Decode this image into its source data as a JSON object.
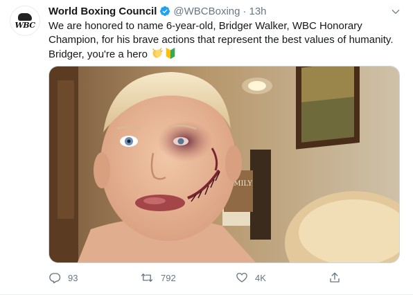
{
  "account": {
    "name": "World Boxing Council",
    "handle": "@WBCBoxing",
    "separator": "·",
    "time": "13h",
    "avatar_text": "WBC"
  },
  "tweet": {
    "text": "We are honored to name 6-year-old, Bridger Walker, WBC Honorary Champion, for his brave actions that represent the best values of humanity. Bridger, you're a hero ",
    "emojis": [
      "clapping-hands-emoji",
      "beginner-symbol-emoji"
    ]
  },
  "media": {
    "sign_text": "FAMILY"
  },
  "actions": {
    "replies": "93",
    "retweets": "792",
    "likes": "4K"
  },
  "colors": {
    "verified": "#1da1f2",
    "secondary_text": "#657786",
    "primary_text": "#14171a",
    "border": "#e6ecf0"
  },
  "icons": {
    "verified": "verified-badge-icon",
    "more": "chevron-down-icon",
    "reply": "reply-icon",
    "retweet": "retweet-icon",
    "like": "heart-icon",
    "share": "share-icon"
  }
}
